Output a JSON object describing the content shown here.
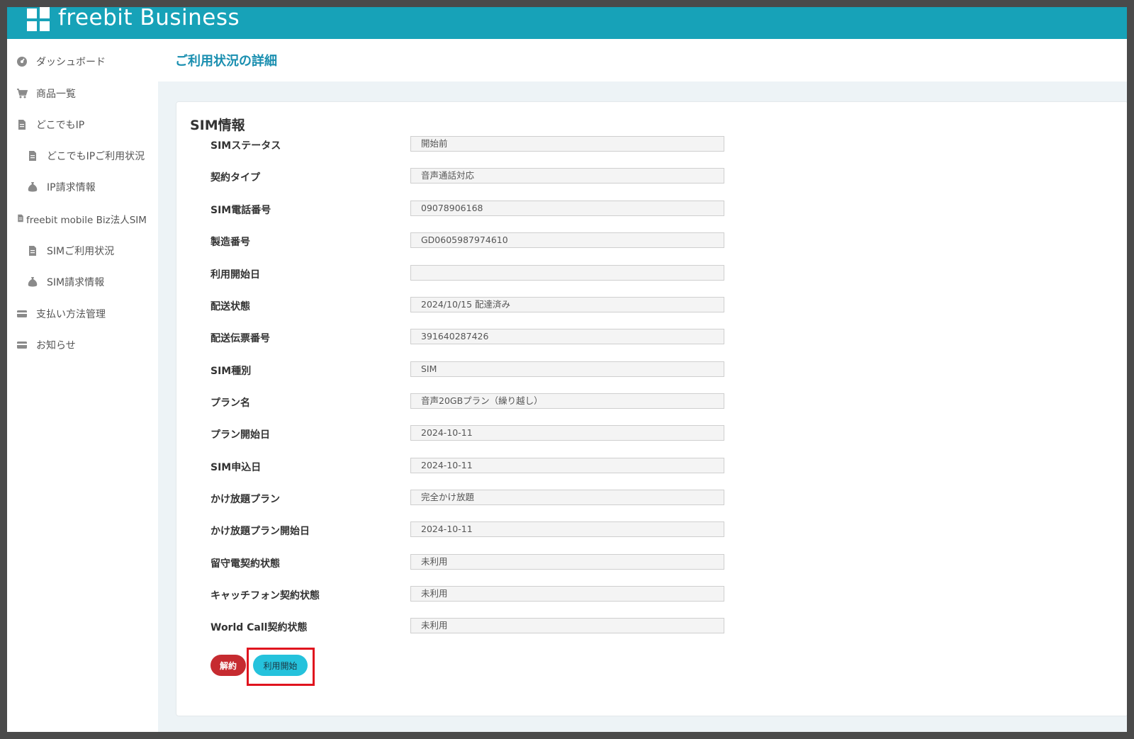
{
  "brand": {
    "name": "freebit Business"
  },
  "sidebar": {
    "items": [
      {
        "label": "ダッシュボード",
        "icon": "dashboard-icon"
      },
      {
        "label": "商品一覧",
        "icon": "cart-icon"
      },
      {
        "label": "どこでもIP",
        "icon": "document-icon"
      },
      {
        "label": "どこでもIPご利用状況",
        "icon": "document-icon"
      },
      {
        "label": "IP請求情報",
        "icon": "money-bag-icon"
      },
      {
        "label": "freebit mobile Biz法人SIM",
        "icon": "document-icon"
      },
      {
        "label": "SIMご利用状況",
        "icon": "document-icon"
      },
      {
        "label": "SIM請求情報",
        "icon": "money-bag-icon"
      },
      {
        "label": "支払い方法管理",
        "icon": "credit-card-icon"
      },
      {
        "label": "お知らせ",
        "icon": "credit-card-icon"
      }
    ]
  },
  "page": {
    "title": "ご利用状況の詳細"
  },
  "sim_info": {
    "section_title": "SIM情報",
    "fields": [
      {
        "label": "SIMステータス",
        "value": "開始前"
      },
      {
        "label": "契約タイプ",
        "value": "音声通話対応"
      },
      {
        "label": "SIM電話番号",
        "value": "09078906168"
      },
      {
        "label": "製造番号",
        "value": "GD0605987974610"
      },
      {
        "label": "利用開始日",
        "value": ""
      },
      {
        "label": "配送状態",
        "value": "2024/10/15 配達済み"
      },
      {
        "label": "配送伝票番号",
        "value": "391640287426"
      },
      {
        "label": "SIM種別",
        "value": "SIM"
      },
      {
        "label": "プラン名",
        "value": "音声20GBプラン（繰り越し）"
      },
      {
        "label": "プラン開始日",
        "value": "2024-10-11"
      },
      {
        "label": "SIM申込日",
        "value": "2024-10-11"
      },
      {
        "label": "かけ放題プラン",
        "value": "完全かけ放題"
      },
      {
        "label": "かけ放題プラン開始日",
        "value": "2024-10-11"
      },
      {
        "label": "留守電契約状態",
        "value": "未利用"
      },
      {
        "label": "キャッチフォン契約状態",
        "value": "未利用"
      },
      {
        "label": "World Call契約状態",
        "value": "未利用"
      }
    ]
  },
  "actions": {
    "cancel_label": "解約",
    "start_label": "利用開始"
  },
  "colors": {
    "brand": "#17a2b8",
    "title": "#1a8fb0",
    "cancel": "#c62b30",
    "start": "#25c2dc",
    "highlight": "#e0141e"
  }
}
